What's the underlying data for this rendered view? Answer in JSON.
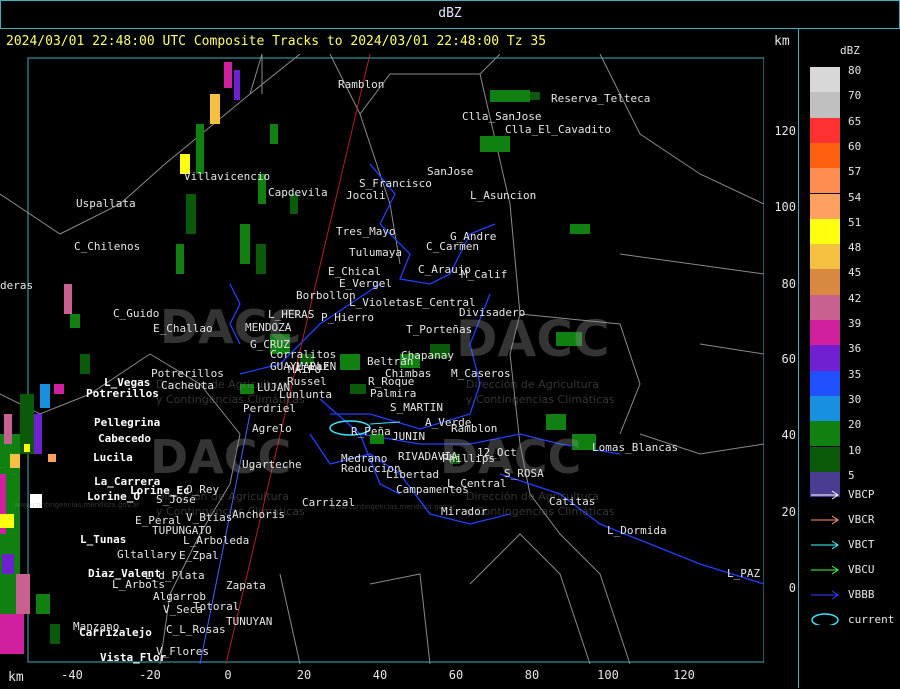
{
  "header": {
    "title": "dBZ",
    "subtitle": "2024/03/01 22:48:00 UTC Composite Tracks to 2024/03/01 22:48:00 Tz 35",
    "km_top": "km",
    "km_bottom": "km"
  },
  "axes": {
    "x_ticks": [
      "-40",
      "-20",
      "0",
      "20",
      "40",
      "60",
      "80",
      "100",
      "120"
    ],
    "y_ticks": [
      "120",
      "100",
      "80",
      "60",
      "40",
      "20",
      "0"
    ]
  },
  "legend": {
    "title": "dBZ",
    "levels": [
      {
        "value": "80",
        "color": "#d8d8d8"
      },
      {
        "value": "70",
        "color": "#c0c0c0"
      },
      {
        "value": "65",
        "color": "#ff3030"
      },
      {
        "value": "60",
        "color": "#ff6010"
      },
      {
        "value": "57",
        "color": "#ff8c50"
      },
      {
        "value": "54",
        "color": "#ffa060"
      },
      {
        "value": "51",
        "color": "#ffff10"
      },
      {
        "value": "48",
        "color": "#f6c040"
      },
      {
        "value": "45",
        "color": "#d88840"
      },
      {
        "value": "42",
        "color": "#c86090"
      },
      {
        "value": "39",
        "color": "#d020a0"
      },
      {
        "value": "36",
        "color": "#7020d0"
      },
      {
        "value": "35",
        "color": "#2050ff"
      },
      {
        "value": "30",
        "color": "#1890e0"
      },
      {
        "value": "20",
        "color": "#108010"
      },
      {
        "value": "10",
        "color": "#0a5a0a"
      },
      {
        "value": "5",
        "color": "#4a3c90"
      }
    ],
    "tracks": [
      {
        "name": "VBCP",
        "color": "#ffffff"
      },
      {
        "name": "VBCR",
        "color": "#ff9a7a"
      },
      {
        "name": "VBCT",
        "color": "#40ffff"
      },
      {
        "name": "VBCU",
        "color": "#40ff40"
      },
      {
        "name": "VBBB",
        "color": "#3040ff"
      },
      {
        "name": "current",
        "color": "#40e0ff"
      }
    ]
  },
  "watermark": {
    "brand": "DACC",
    "line1": "Dirección de Agricultura",
    "line2": "y Contingencias Climáticas",
    "url": "www.contingencias.mendoza.gov.ar"
  },
  "places": [
    {
      "name": "Ramblon",
      "color": "#e6e6e6"
    },
    {
      "name": "Reserva_Telteca",
      "color": "#e6e6e6"
    },
    {
      "name": "Clla_SanJose",
      "color": "#e6e6e6"
    },
    {
      "name": "Clla_El_Cavadito",
      "color": "#e6e6e6"
    },
    {
      "name": "SanJose",
      "color": "#e6e6e6"
    },
    {
      "name": "S_Francisco",
      "color": "#e6e6e6"
    },
    {
      "name": "Jocoli",
      "color": "#e6e6e6"
    },
    {
      "name": "L_Asuncion",
      "color": "#e6e6e6"
    },
    {
      "name": "Villavicencio",
      "color": "#e6e6e6"
    },
    {
      "name": "Capdevila",
      "color": "#e6e6e6"
    },
    {
      "name": "Uspallata",
      "color": "#e6e6e6"
    },
    {
      "name": "C_Chilenos",
      "color": "#e6e6e6"
    },
    {
      "name": "Tres_Mayo",
      "color": "#e6e6e6"
    },
    {
      "name": "Tulumaya",
      "color": "#e6e6e6"
    },
    {
      "name": "G_Andre",
      "color": "#e6e6e6"
    },
    {
      "name": "C_Carmen",
      "color": "#e6e6e6"
    },
    {
      "name": "E_Chical",
      "color": "#e6e6e6"
    },
    {
      "name": "C_Araujo",
      "color": "#e6e6e6"
    },
    {
      "name": "M_Calif",
      "color": "#e6e6e6"
    },
    {
      "name": "E_Vergel",
      "color": "#e6e6e6"
    },
    {
      "name": "Borbollon",
      "color": "#e6e6e6"
    },
    {
      "name": "L_Violetas",
      "color": "#e6e6e6"
    },
    {
      "name": "E_Central",
      "color": "#e6e6e6"
    },
    {
      "name": "Divisadero",
      "color": "#e6e6e6"
    },
    {
      "name": "deras",
      "color": "#e6e6e6"
    },
    {
      "name": "C_Guido",
      "color": "#e6e6e6"
    },
    {
      "name": "E_Challao",
      "color": "#e6e6e6"
    },
    {
      "name": "MENDOZA",
      "color": "#e6e6e6"
    },
    {
      "name": "L_HERAS",
      "color": "#e6e6e6"
    },
    {
      "name": "P_Hierro",
      "color": "#e6e6e6"
    },
    {
      "name": "T_Porteñas",
      "color": "#e6e6e6"
    },
    {
      "name": "G_CRUZ",
      "color": "#e6e6e6"
    },
    {
      "name": "Corralitos",
      "color": "#e6e6e6"
    },
    {
      "name": "GUAYMALLEN",
      "color": "#e6e6e6"
    },
    {
      "name": "L_Paz",
      "color": "#e6e6e6"
    },
    {
      "name": "Beltran",
      "color": "#e6e6e6"
    },
    {
      "name": "Chapanay",
      "color": "#e6e6e6"
    },
    {
      "name": "MAIPU",
      "color": "#e6e6e6"
    },
    {
      "name": "Chimbas",
      "color": "#e6e6e6"
    },
    {
      "name": "M_Caseros",
      "color": "#e6e6e6"
    },
    {
      "name": "Potrerillos",
      "color": "#e6e6e6"
    },
    {
      "name": "L_Vegas",
      "color": "#ffffff"
    },
    {
      "name": "Potrerillos",
      "color": "#ffffff"
    },
    {
      "name": "Cacheuta",
      "color": "#e6e6e6"
    },
    {
      "name": "Russel",
      "color": "#e6e6e6"
    },
    {
      "name": "R_Roque",
      "color": "#e6e6e6"
    },
    {
      "name": "LUJAN",
      "color": "#e6e6e6"
    },
    {
      "name": "Lunlunta",
      "color": "#e6e6e6"
    },
    {
      "name": "Palmira",
      "color": "#e6e6e6"
    },
    {
      "name": "Perdriel",
      "color": "#e6e6e6"
    },
    {
      "name": "S_MARTIN",
      "color": "#e6e6e6"
    },
    {
      "name": "Pellegrina",
      "color": "#ffffff"
    },
    {
      "name": "Agrelo",
      "color": "#e6e6e6"
    },
    {
      "name": "R_Peña",
      "color": "#e6e6e6"
    },
    {
      "name": "JUNIN",
      "color": "#e6e6e6"
    },
    {
      "name": "A_Verde",
      "color": "#e6e6e6"
    },
    {
      "name": "Ramblon",
      "color": "#e6e6e6"
    },
    {
      "name": "Cabecedo",
      "color": "#ffffff"
    },
    {
      "name": "Lomas_Blancas",
      "color": "#e6e6e6"
    },
    {
      "name": "Lucila",
      "color": "#ffffff"
    },
    {
      "name": "Ugarteche",
      "color": "#e6e6e6"
    },
    {
      "name": "Medrano",
      "color": "#e6e6e6"
    },
    {
      "name": "RIVADAVIA",
      "color": "#e6e6e6"
    },
    {
      "name": "Phillips",
      "color": "#e6e6e6"
    },
    {
      "name": "12_Oct",
      "color": "#e6e6e6"
    },
    {
      "name": "Reduccion",
      "color": "#e6e6e6"
    },
    {
      "name": "Libertad",
      "color": "#e6e6e6"
    },
    {
      "name": "S_ROSA",
      "color": "#e6e6e6"
    },
    {
      "name": "La_Carrera",
      "color": "#ffffff"
    },
    {
      "name": "Lorine_Ec",
      "color": "#ffffff"
    },
    {
      "name": "O_Rey",
      "color": "#e6e6e6"
    },
    {
      "name": "L_Central",
      "color": "#e6e6e6"
    },
    {
      "name": "Campamentos",
      "color": "#e6e6e6"
    },
    {
      "name": "Lorine_O",
      "color": "#ffffff"
    },
    {
      "name": "S_Jose",
      "color": "#e6e6e6"
    },
    {
      "name": "Carrizal",
      "color": "#e6e6e6"
    },
    {
      "name": "Catitas",
      "color": "#e6e6e6"
    },
    {
      "name": "Anchoris",
      "color": "#e6e6e6"
    },
    {
      "name": "Mirador",
      "color": "#e6e6e6"
    },
    {
      "name": "E_Peral",
      "color": "#e6e6e6"
    },
    {
      "name": "V_Btias",
      "color": "#e6e6e6"
    },
    {
      "name": "TUPUNGATO",
      "color": "#e6e6e6"
    },
    {
      "name": "L_Dormida",
      "color": "#e6e6e6"
    },
    {
      "name": "L_Tunas",
      "color": "#ffffff"
    },
    {
      "name": "L_Arboleda",
      "color": "#e6e6e6"
    },
    {
      "name": "Gltallary",
      "color": "#e6e6e6"
    },
    {
      "name": "E_Zpal",
      "color": "#e6e6e6"
    },
    {
      "name": "Diaz_Valent",
      "color": "#ffffff"
    },
    {
      "name": "L_d_Plata",
      "color": "#e6e6e6"
    },
    {
      "name": "Zapata",
      "color": "#e6e6e6"
    },
    {
      "name": "L_PAZ",
      "color": "#e6e6e6"
    },
    {
      "name": "L_Arbols",
      "color": "#e6e6e6"
    },
    {
      "name": "Algarrob",
      "color": "#e6e6e6"
    },
    {
      "name": "V_Seca",
      "color": "#e6e6e6"
    },
    {
      "name": "Totoral",
      "color": "#e6e6e6"
    },
    {
      "name": "Manzano",
      "color": "#e6e6e6"
    },
    {
      "name": "Carrizalejo",
      "color": "#ffffff"
    },
    {
      "name": "C_L_Rosas",
      "color": "#e6e6e6"
    },
    {
      "name": "TUNUYAN",
      "color": "#e6e6e6"
    },
    {
      "name": "V_Flores",
      "color": "#e6e6e6"
    },
    {
      "name": "Vista_Flor",
      "color": "#ffffff"
    }
  ]
}
